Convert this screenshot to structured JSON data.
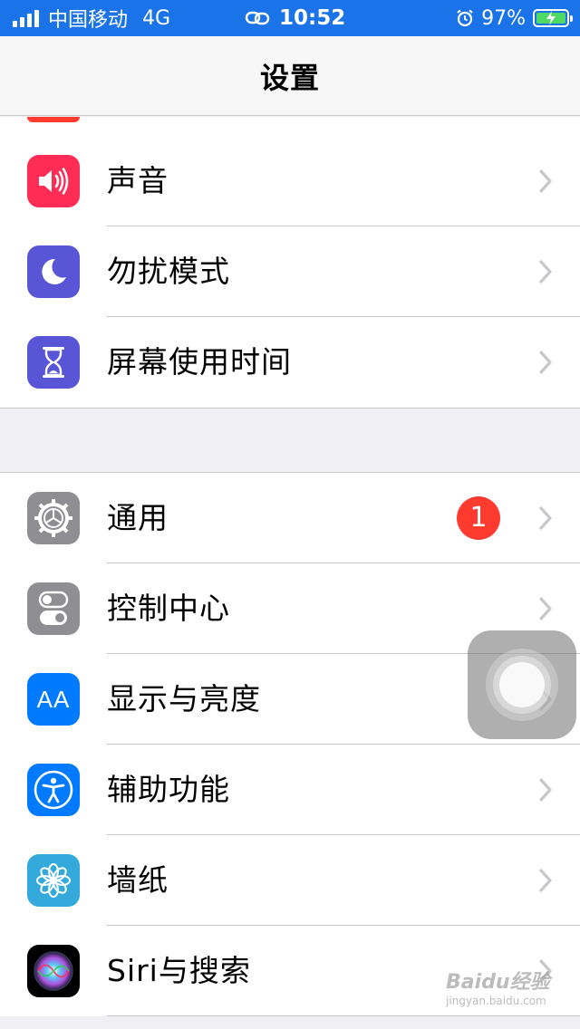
{
  "status_bar": {
    "carrier": "中国移动",
    "network": "4G",
    "time": "10:52",
    "battery": "97%",
    "icons": [
      "signal-icon",
      "link-icon",
      "alarm-icon",
      "battery-charging-icon"
    ]
  },
  "nav": {
    "title": "设置"
  },
  "group1": [
    {
      "label": "声音",
      "icon": "speaker-icon",
      "color": "#ff2d55"
    },
    {
      "label": "勿扰模式",
      "icon": "moon-icon",
      "color": "#5856d6"
    },
    {
      "label": "屏幕使用时间",
      "icon": "hourglass-icon",
      "color": "#5856d6"
    }
  ],
  "group2": [
    {
      "label": "通用",
      "icon": "gear-icon",
      "color": "#8e8e93",
      "badge": "1"
    },
    {
      "label": "控制中心",
      "icon": "toggles-icon",
      "color": "#8e8e93"
    },
    {
      "label": "显示与亮度",
      "icon": "text-size-icon",
      "color": "#007aff",
      "icon_text": "AA"
    },
    {
      "label": "辅助功能",
      "icon": "accessibility-icon",
      "color": "#007aff"
    },
    {
      "label": "墙纸",
      "icon": "flower-icon",
      "color": "#34aadc"
    },
    {
      "label": "Siri与搜索",
      "icon": "siri-icon",
      "color": "#000000"
    }
  ],
  "watermark": {
    "brand": "Baidu经验",
    "url": "jingyan.baidu.com"
  }
}
